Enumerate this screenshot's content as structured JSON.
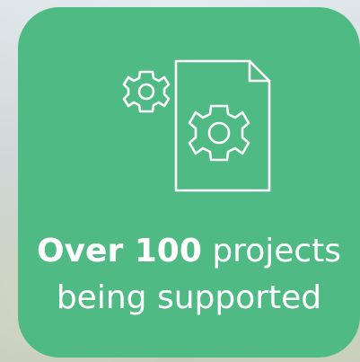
{
  "card": {
    "highlight": "Over 100",
    "line1_rest": "projects",
    "line2": "being supported",
    "icon": "document-gears-icon",
    "background_color": "#4fba83",
    "text_color": "#ffffff"
  }
}
